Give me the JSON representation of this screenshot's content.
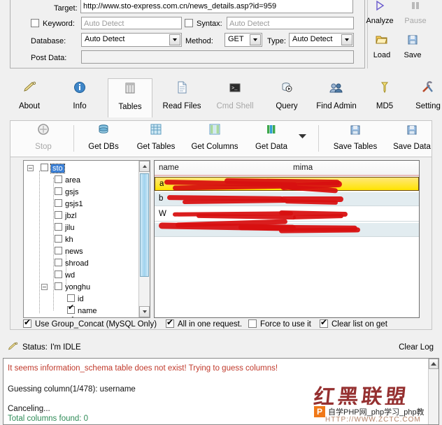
{
  "target_panel": {
    "target_label": "Target:",
    "target_value": "http://www.sto-express.com.cn/news_details.asp?id=959",
    "keyword_label": "Keyword:",
    "keyword_placeholder": "Auto Detect",
    "syntax_label": "Syntax:",
    "syntax_placeholder": "Auto Detect",
    "database_label": "Database:",
    "database_value": "Auto Detect",
    "method_label": "Method:",
    "method_value": "GET",
    "type_label": "Type:",
    "type_value": "Auto Detect",
    "post_data_label": "Post Data:",
    "post_data_value": ""
  },
  "side_buttons": [
    {
      "label": "Analyze",
      "icon": "play-icon",
      "enabled": true
    },
    {
      "label": "Pause",
      "icon": "pause-icon",
      "enabled": false
    },
    {
      "label": "Load",
      "icon": "folder-open-icon",
      "enabled": true
    },
    {
      "label": "Save",
      "icon": "floppy-disk-icon",
      "enabled": true
    }
  ],
  "tabs": [
    {
      "label": "About",
      "icon": "pencil-icon",
      "selected": false,
      "enabled": true
    },
    {
      "label": "Info",
      "icon": "info-icon",
      "selected": false,
      "enabled": true
    },
    {
      "label": "Tables",
      "icon": "table-icon",
      "selected": true,
      "enabled": true
    },
    {
      "label": "Read Files",
      "icon": "document-icon",
      "selected": false,
      "enabled": true
    },
    {
      "label": "Cmd Shell",
      "icon": "console-icon",
      "selected": false,
      "enabled": false
    },
    {
      "label": "Query",
      "icon": "query-icon",
      "selected": false,
      "enabled": true
    },
    {
      "label": "Find Admin",
      "icon": "users-icon",
      "selected": false,
      "enabled": true
    },
    {
      "label": "MD5",
      "icon": "key-icon",
      "selected": false,
      "enabled": true
    },
    {
      "label": "Setting",
      "icon": "tools-icon",
      "selected": false,
      "enabled": true
    }
  ],
  "action_bar": [
    {
      "label": "Stop",
      "icon": "stop-icon",
      "enabled": false
    },
    {
      "label": "Get DBs",
      "icon": "database-icon",
      "enabled": true
    },
    {
      "label": "Get Tables",
      "icon": "table-grid-icon",
      "enabled": true
    },
    {
      "label": "Get Columns",
      "icon": "columns-icon",
      "enabled": true
    },
    {
      "label": "Get Data",
      "icon": "data-bars-icon",
      "enabled": true
    },
    {
      "label": "Save Tables",
      "icon": "floppy-disk-icon",
      "enabled": true
    },
    {
      "label": "Save Data",
      "icon": "floppy-disk-icon",
      "enabled": true
    }
  ],
  "action_bar_dropdown_icon": "chevron-down-icon",
  "tree": {
    "root": {
      "label": "sto",
      "checked": false,
      "expanded": true,
      "selected": true
    },
    "children": [
      {
        "label": "area",
        "checked": false,
        "expandable": false
      },
      {
        "label": "gsjs",
        "checked": false,
        "expandable": false
      },
      {
        "label": "gsjs1",
        "checked": false,
        "expandable": false
      },
      {
        "label": "jbzl",
        "checked": false,
        "expandable": false
      },
      {
        "label": "jilu",
        "checked": false,
        "expandable": false
      },
      {
        "label": "kh",
        "checked": false,
        "expandable": false
      },
      {
        "label": "news",
        "checked": false,
        "expandable": false
      },
      {
        "label": "shroad",
        "checked": false,
        "expandable": false
      },
      {
        "label": "wd",
        "checked": false,
        "expandable": false
      },
      {
        "label": "yonghu",
        "checked": false,
        "expandable": true,
        "expanded": true
      }
    ],
    "yonghu_columns": [
      {
        "label": "id",
        "checked": false
      },
      {
        "label": "name",
        "checked": true
      },
      {
        "label": "mima",
        "checked": true
      }
    ]
  },
  "grid": {
    "columns": [
      "name",
      "mima"
    ],
    "rows": [
      {
        "name": "a",
        "mima": "",
        "state": "selected",
        "redacted": true
      },
      {
        "name": "b",
        "mima": "",
        "state": "alternate",
        "redacted": true
      },
      {
        "name": "W",
        "mima": "",
        "state": "plain",
        "redacted": true
      },
      {
        "name": "",
        "mima": "",
        "state": "alternate",
        "redacted": true
      }
    ]
  },
  "options": [
    {
      "label": "Use Group_Concat (MySQL Only)",
      "checked": true
    },
    {
      "label": "All in one request.",
      "checked": true
    },
    {
      "label": "Force to use it",
      "checked": false
    },
    {
      "label": "Clear list on get",
      "checked": true
    }
  ],
  "status": {
    "icon": "pencil-icon",
    "label": "Status:",
    "value": "I'm IDLE",
    "clear_log": "Clear Log"
  },
  "log": {
    "lines": [
      {
        "text": "It seems information_schema table does not exist! Trying to guess columns!",
        "color": "#c0392b"
      },
      {
        "text": "Guessing column(1/478): username",
        "color": "#111111"
      },
      {
        "text": "Canceling...",
        "color": "#111111"
      },
      {
        "text": "Total columns found: 0",
        "color": "#2e8b57"
      }
    ],
    "scroll_up_icon": "caret-up-icon"
  },
  "watermark": {
    "title": "红黑联盟",
    "badge": "P",
    "caption": "自学PHP网_php学习_php教",
    "url": "HTTP://WWW.ZCTC.COM"
  },
  "colors": {
    "accent_red": "#d81010",
    "selected_row": "#ffe400",
    "alt_row": "#e2ecf0",
    "tree_select": "#3a7fd5",
    "log_error": "#c0392b",
    "log_success": "#2e8b57"
  }
}
